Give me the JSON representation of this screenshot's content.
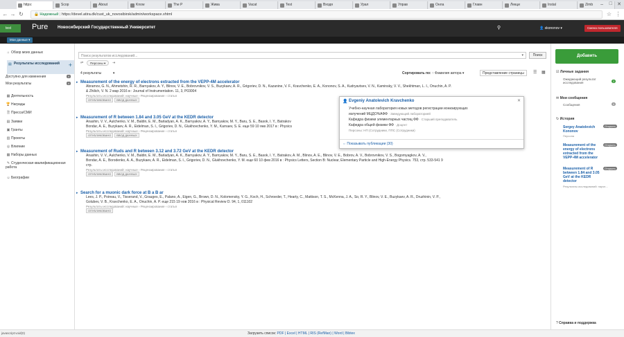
{
  "browser": {
    "tabs": [
      "https:",
      "Scop",
      "About",
      "Know",
      "The P",
      "Жива",
      "Vacat",
      "Test",
      "Входя",
      "Урал",
      "Управ",
      "Онла",
      "Главн",
      "Лекци",
      "Instal",
      "Zimb"
    ],
    "secure_label": "Надежный",
    "url": "https://devel.atira.dk/cust_uk_novosibirsk/admin/workspace.xhtml"
  },
  "header": {
    "env": "test",
    "logo": "Pure",
    "org": "Новосибирский Государственный Университет",
    "user": "skononov",
    "role_badge": "Смена пользователя",
    "my_data": "Мои данные"
  },
  "sidebar": {
    "overview": "Обзор моих данных",
    "selected": "Результаты исследований",
    "sub": [
      {
        "label": "Доступно для изменения",
        "count": "4"
      },
      {
        "label": "Мои результаты",
        "count": "4"
      }
    ],
    "items": [
      {
        "icon": "activity-icon",
        "glyph": "▦",
        "label": "Деятельность"
      },
      {
        "icon": "award-icon",
        "glyph": "🏆",
        "label": "Награды"
      },
      {
        "icon": "press-icon",
        "glyph": "🗎",
        "label": "Пресса/СМИ"
      },
      {
        "icon": "application-icon",
        "glyph": "▤",
        "label": "Заявки"
      },
      {
        "icon": "grant-icon",
        "glyph": "▣",
        "label": "Гранты"
      },
      {
        "icon": "project-icon",
        "glyph": "▥",
        "label": "Проекты"
      },
      {
        "icon": "impact-icon",
        "glyph": "◎",
        "label": "Влияние"
      },
      {
        "icon": "dataset-icon",
        "glyph": "▦",
        "label": "Наборы данных"
      },
      {
        "icon": "thesis-icon",
        "glyph": "✎",
        "label": "Студенческая квалификационная работа"
      },
      {
        "icon": "biography-icon",
        "glyph": "☺",
        "label": "Биографии"
      }
    ]
  },
  "search": {
    "placeholder": "Поиск результатов исследований...",
    "button": "Поиск",
    "filter": "Персоны",
    "count": "4 результаты",
    "sort_label": "Сортировать по:",
    "sort_value": "Фамилия автора",
    "view": "Представление страницы"
  },
  "pubs": [
    {
      "title": "Measurement of the energy of electrons extracted from the VEPP-4M accelerator",
      "authors": "Abramov, G. N., Ahmetshin, R. R., Barnyakov, A. Y., Blinov, V. E., Bobrovnikov, V. S., Buzykaev, A. R., Grigoriev, D. N., Kazanine, V. F., Kravchenko, E. A., Kononov, S. A., Kudryavtsev, V. N., Kaminsky, V. V., Shekhtman, L. I., Onuchin, A. P.",
      "line2": "& Zhilich, V. N. 2 мар 2016 в : Journal of Instrumentation. 11, 3, P03004",
      "meta": "Результаты исследований: научные › Рецензирование › статья",
      "tags": [
        "ОПУБЛИКОВАНО",
        "ВВОД ДАННЫХ"
      ]
    },
    {
      "title": "Measurement of R between 1.84 and 3.05 GeV at the KEDR detector",
      "authors": "Anashin, V. V., Aulchenko, V. M., Baldin, E. M., Barladyan, A. K., Barnyakov, A. Y., Barnyakov, M. Y., Baru, S. E., Basok, I. Y., Batrakov",
      "line2": "Bondar, A. E., Buzykaev, A. R., Eidelman, S. I., Grigoriev, D. N., Glukhovchenko, Y. M., Karnaev, S. E. еще 59 10 янв 2017 в : Physics",
      "meta": "Результаты исследований: научные › Рецензирование › статья",
      "tags": [
        "ОПУБЛИКОВАНО",
        "ВВОД ДАННЫХ"
      ]
    },
    {
      "title": "Measurement of Ruds and R between 3.12 and 3.72 GeV at the KEDR detector",
      "authors": "Anashin, V. V., Aulchenko, V. M., Baldin, E. M., Barladyan, A. K., Barnyakov, A. Y., Barnyakov, M. Y., Baru, S. E., Basok, I. Y., Batrakov, A. M., Blinov, A. E., Blinov, V. E., Bobrov, A. V., Bobrovnikov, V. S., Bogomyagkov, A. V.,",
      "line2": "Bondar, A. E., Borodenko, A. A., Buzykaev, A. R., Eidelman, S. I., Grigoriev, D. N., Glukhovchenko, Y. M. еще 60 10 фев 2016 в : Physics Letters, Section B: Nuclear, Elementary Particle and High-Energy Physics. 753, стр. 533-541 9",
      "line3": "стр.",
      "meta": "Результаты исследований: научные › Рецензирование › статья",
      "tags": [
        "ОПУБЛИКОВАНО",
        "ВВОД ДАННЫХ"
      ]
    },
    {
      "title": "Search for a muonic dark force at B a B ar",
      "authors": "Lees, J. P., Poireau, V., Tisserand, V., Grauges, E., Palano, A., Eigen, G., Brown, D. N., Kolomensky, Y. G., Koch, H., Schroeder, T., Hearty, C., Mattison, T. S., McKenna, J. A., So, R. Y., Blinov, V. E., Buzykaev, A. R., Druzhinin, V. P.,",
      "line2": "Golubev, V. B., Kravchenko, E. A., Onuchin, A. P. еще 215 19 нов 2016 в : Physical Review D. 94, 1, 011102",
      "meta": "Результаты исследований: научные › Рецензирование › статья",
      "tags": [
        "ОПУБЛИКОВАНО"
      ]
    }
  ],
  "popup": {
    "name": "Evgeniy Anatolevich Kravchenko",
    "l1": "Учебно-научная лаборатория новых методов регистрации ионизирующих",
    "l2": "излучений МЦДО%АФФ",
    "l2b": "· Заведующий лабораторией",
    "l3": "Кафедра физики элементарных частиц ФФ",
    "l3b": "· Старший преподаватель",
    "l4": "Кафедра общей физики ФФ",
    "l4b": "· Доцент",
    "role": "Персоны: НП (Сотрудники, ППС (Сотрудники)",
    "link": "Показывать публикации (30)"
  },
  "right": {
    "add": "Добавить",
    "tasks": "Личные задания",
    "tasks_sub": "Ожидающий результат исследования",
    "tasks_count": "2",
    "messages": "Мои сообщения",
    "msg_sub": "Сообщения",
    "msg_count": "0",
    "history": "История",
    "hist": [
      {
        "title": "Sergey Anatolevich Kononov",
        "sub": "Персона",
        "badge": "Открыть"
      },
      {
        "title": "Measurement of the energy of electrons extracted from the VEPP-4M accelerator",
        "sub": "",
        "badge": "Открыть"
      },
      {
        "title": "Measurement of R between 1.84 and 3.05 GeV at the KEDR detector",
        "sub": "Результаты исследований: научн...",
        "badge": "Открыть"
      }
    ],
    "help": "Справка и поддержка"
  },
  "footer": {
    "status": "javascript:void(0)",
    "download": "Загрузить список:",
    "formats": "PDF | Excel | HTML | RIS (RefMan) | Word | Bibtex"
  },
  "colors": {
    "accent": "#1a5fa8",
    "green": "#3a9c3a",
    "red": "#c0272d",
    "header": "#2b2b2b"
  }
}
